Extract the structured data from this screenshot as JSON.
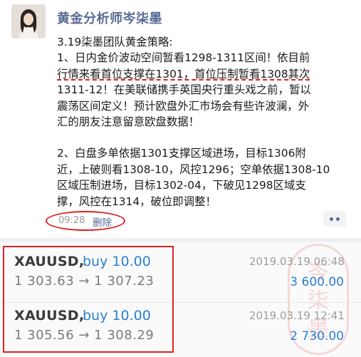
{
  "post": {
    "author": "黄金分析师岑柒墨",
    "lines": [
      "3.19柒墨团队黄金策略:",
      "1、日内金价波动空间暂看1298-1311区间！依目前",
      "行情来看首位支撑在1301，首位压制暂看1308其次",
      "1311-12！在美联储携手英国央行重头戏之前，暂以",
      "震荡区间定义！预计欧盘外汇市场会有些许波澜，外",
      "汇的朋友注意留意欧盘数据！",
      "2、白盘多单依据1301支撑区域进场，目标1306附",
      "近，上破则看1308-10，风控1296；空单依据1308-10",
      "区域压制进场，目标1302-04，下破见1298区域支",
      "撑，风控在1314，破位即调整！"
    ],
    "time": "09:28",
    "delete_label": "删除",
    "more_icon": "more-dots-icon"
  },
  "trades": [
    {
      "symbol": "XAUUSD,",
      "side": "buy 10.00",
      "prices": "1 303.63 → 1 307.23",
      "datetime": "2019.03.19 06:48",
      "profit": "3 600.00"
    },
    {
      "symbol": "XAUUSD,",
      "side": "buy 10.00",
      "prices": "1 305.56 → 1 308.29",
      "datetime": "2019.03.19 12:41",
      "profit": "2 730.00"
    }
  ],
  "stamp": {
    "chars": [
      "岑",
      "柒",
      "墨"
    ]
  },
  "colors": {
    "link_blue": "#576b95",
    "trade_blue": "#2a7fd4",
    "annotation_red": "#e02020"
  }
}
